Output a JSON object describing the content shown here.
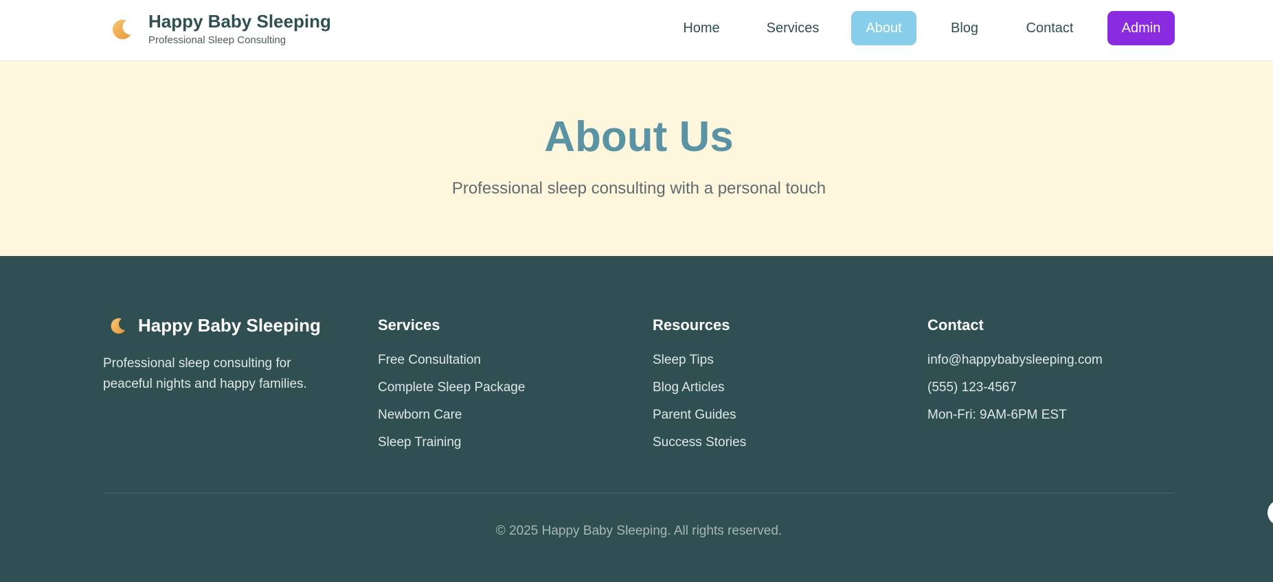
{
  "header": {
    "logo_icon": "crescent-moon-icon",
    "brand_title": "Happy Baby Sleeping",
    "brand_subtitle": "Professional Sleep Consulting",
    "nav": [
      {
        "label": "Home",
        "active": false
      },
      {
        "label": "Services",
        "active": false
      },
      {
        "label": "About",
        "active": true
      },
      {
        "label": "Blog",
        "active": false
      },
      {
        "label": "Contact",
        "active": false
      }
    ],
    "admin_label": "Admin"
  },
  "hero": {
    "title": "About Us",
    "subtitle": "Professional sleep consulting with a personal touch"
  },
  "footer": {
    "brand_icon": "crescent-moon-icon",
    "brand_title": "Happy Baby Sleeping",
    "description": "Professional sleep consulting for peaceful nights and happy families.",
    "columns": [
      {
        "heading": "Services",
        "links": [
          "Free Consultation",
          "Complete Sleep Package",
          "Newborn Care",
          "Sleep Training"
        ]
      },
      {
        "heading": "Resources",
        "links": [
          "Sleep Tips",
          "Blog Articles",
          "Parent Guides",
          "Success Stories"
        ]
      },
      {
        "heading": "Contact",
        "links": [
          "info@happybabysleeping.com",
          "(555) 123-4567",
          "Mon-Fri: 9AM-6PM EST"
        ]
      }
    ],
    "copyright": "© 2025 Happy Baby Sleeping. All rights reserved."
  },
  "colors": {
    "brand_dark": "#2f4f52",
    "accent_sky": "#87ceeb",
    "admin_purple": "#8a2be2",
    "hero_bg": "#fff7dd",
    "hero_title": "#5a93a3"
  }
}
